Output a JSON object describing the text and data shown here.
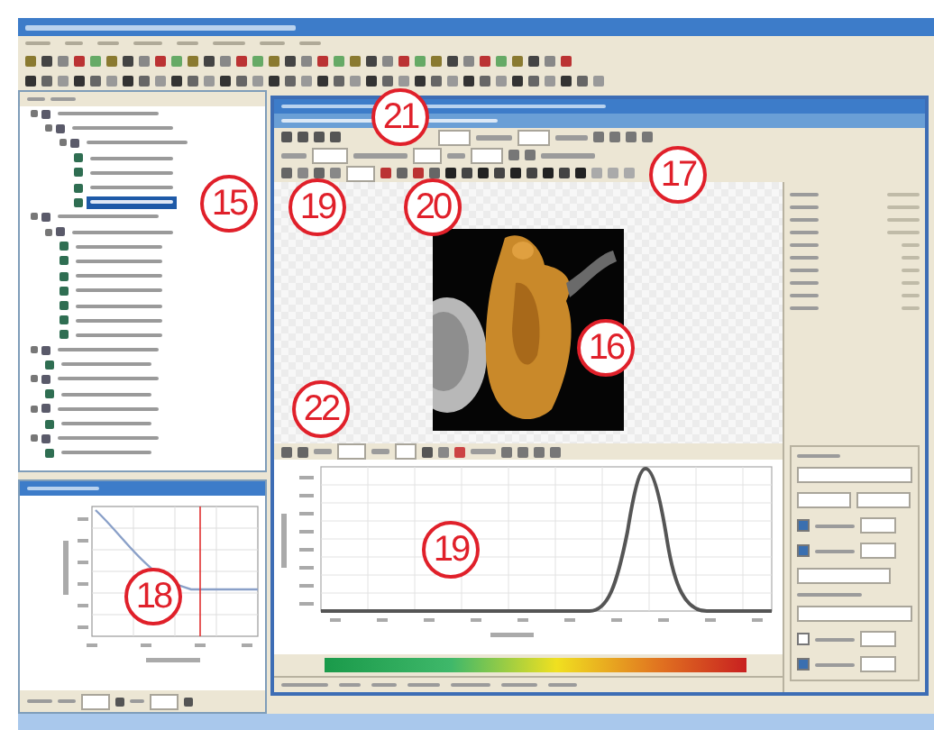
{
  "callouts": {
    "child_window": "21",
    "tree": "15",
    "image_toolbar": [
      "19",
      "20"
    ],
    "settings_toolbar": "17",
    "image": "16",
    "plot_toolbar": "22",
    "decay_plot": "18",
    "spectrum_plot": "19"
  },
  "tree": {
    "items": [
      {
        "selected": false,
        "children": [
          {
            "selected": false,
            "children": [
              {
                "selected": false,
                "children": [
                  {
                    "selected": false
                  },
                  {
                    "selected": false
                  },
                  {
                    "selected": false
                  },
                  {
                    "selected": true
                  }
                ]
              }
            ]
          }
        ]
      },
      {
        "selected": false,
        "children": [
          {
            "selected": false,
            "children": [
              {
                "selected": false
              },
              {
                "selected": false
              },
              {
                "selected": false
              },
              {
                "selected": false
              },
              {
                "selected": false
              },
              {
                "selected": false
              },
              {
                "selected": false
              }
            ]
          }
        ]
      },
      {
        "selected": false,
        "children": [
          {
            "selected": false
          }
        ]
      },
      {
        "selected": false,
        "children": [
          {
            "selected": false
          }
        ]
      },
      {
        "selected": false,
        "children": [
          {
            "selected": false
          }
        ]
      },
      {
        "selected": false,
        "children": [
          {
            "selected": false
          }
        ]
      }
    ]
  },
  "color_scale": {
    "checkboxes": [
      {
        "checked": true
      },
      {
        "checked": true
      },
      {
        "checked": false
      },
      {
        "checked": true
      }
    ]
  }
}
